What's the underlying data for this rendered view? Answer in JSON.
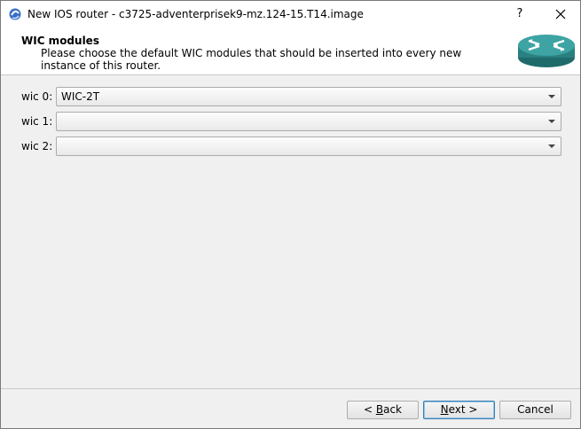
{
  "window": {
    "title": "New IOS router - c3725-adventerprisek9-mz.124-15.T14.image",
    "help_label": "?",
    "app_icon": "app-icon",
    "close_icon": "close-icon"
  },
  "header": {
    "title": "WIC modules",
    "subtitle": "Please choose the default WIC modules that should be inserted into every new instance of this router.",
    "image_icon": "router-icon",
    "router_color": "#2f8f8f"
  },
  "form": {
    "wics": [
      {
        "label": "wic 0:",
        "value": "WIC-2T"
      },
      {
        "label": "wic 1:",
        "value": ""
      },
      {
        "label": "wic 2:",
        "value": ""
      }
    ]
  },
  "footer": {
    "back": {
      "prefix": "< ",
      "mnemonic": "B",
      "rest": "ack"
    },
    "next": {
      "mnemonic": "N",
      "rest": "ext >"
    },
    "cancel": "Cancel"
  }
}
